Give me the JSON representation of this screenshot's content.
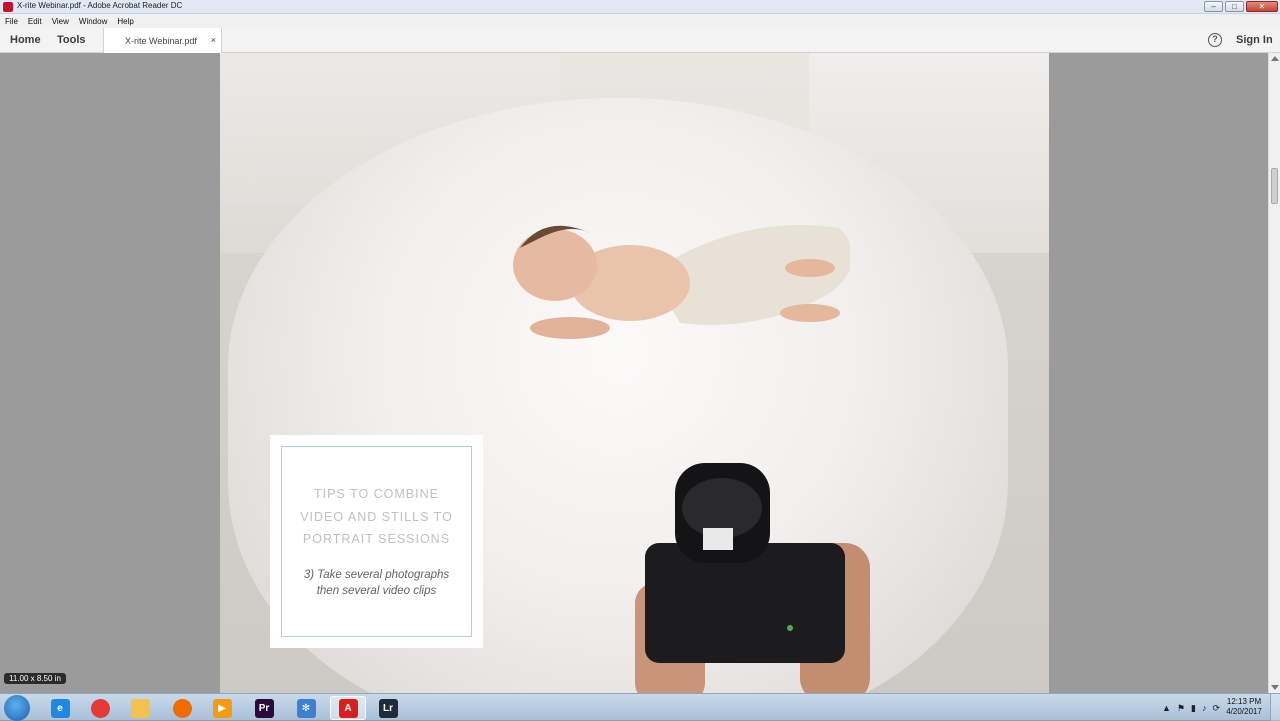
{
  "window": {
    "title": "X-rite Webinar.pdf - Adobe Acrobat Reader DC"
  },
  "menu": [
    "File",
    "Edit",
    "View",
    "Window",
    "Help"
  ],
  "toolbar": {
    "home": "Home",
    "tools": "Tools",
    "sign_in": "Sign In",
    "help_glyph": "?"
  },
  "tab": {
    "label": "X-rite Webinar.pdf",
    "close": "×"
  },
  "page": {
    "title_lines": [
      "TIPS TO COMBINE",
      "VIDEO AND STILLS TO",
      "PORTRAIT SESSIONS"
    ],
    "subtitle_lines": [
      "3) Take several photographs",
      "then several video clips"
    ]
  },
  "status": {
    "page_size": "11.00 x 8.50 in"
  },
  "taskbar": {
    "apps": [
      {
        "name": "internet-explorer-icon",
        "glyph": "e",
        "color": "#1e88e5"
      },
      {
        "name": "chrome-icon",
        "glyph": "",
        "color": "#e53935"
      },
      {
        "name": "file-explorer-icon",
        "glyph": "",
        "color": "#f2c14e"
      },
      {
        "name": "firefox-icon",
        "glyph": "",
        "color": "#ef6c00"
      },
      {
        "name": "media-player-icon",
        "glyph": "▶",
        "color": "#f39c12"
      },
      {
        "name": "premiere-icon",
        "glyph": "Pr",
        "color": "#2a0a3d"
      },
      {
        "name": "snowflake-app-icon",
        "glyph": "✻",
        "color": "#3f7fd1"
      },
      {
        "name": "acrobat-icon",
        "glyph": "A",
        "color": "#d81e1e"
      },
      {
        "name": "lightroom-icon",
        "glyph": "Lr",
        "color": "#1f2a3a"
      }
    ],
    "clock_time": "12:13 PM",
    "clock_date": "4/20/2017"
  },
  "colors": {
    "card_border": "#a9d4d4",
    "card_title": "#b9c2c5",
    "accent_red": "#c8102e"
  }
}
